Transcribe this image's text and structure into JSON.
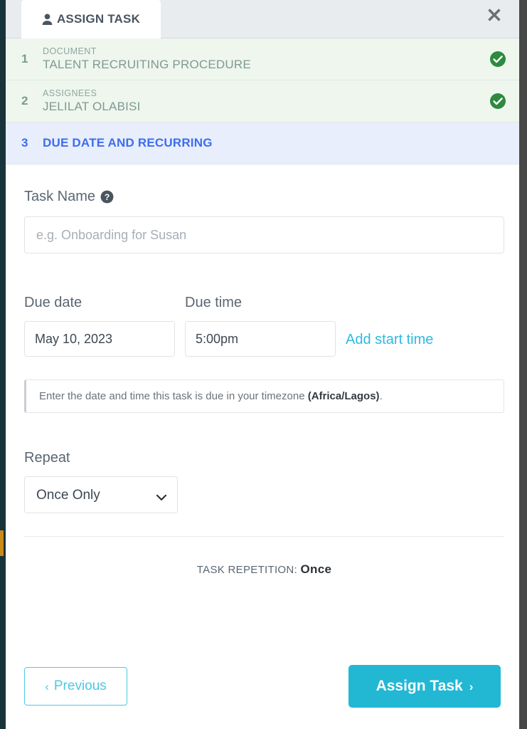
{
  "header": {
    "tab_label": "ASSIGN TASK",
    "tab_icon": "user-icon",
    "close_icon": "close-icon"
  },
  "steps": [
    {
      "number": "1",
      "sub_label": "DOCUMENT",
      "title": "TALENT RECRUITING PROCEDURE",
      "state": "completed",
      "check_icon": "check-circle-icon"
    },
    {
      "number": "2",
      "sub_label": "ASSIGNEES",
      "title": "JELILAT OLABISI",
      "state": "completed",
      "check_icon": "check-circle-icon"
    },
    {
      "number": "3",
      "sub_label": "",
      "title": "DUE DATE AND RECURRING",
      "state": "active",
      "check_icon": ""
    }
  ],
  "form": {
    "task_name_label": "Task Name",
    "task_name_help_icon": "question-circle-icon",
    "task_name_value": "",
    "task_name_placeholder": "e.g. Onboarding for Susan",
    "due_date_label": "Due date",
    "due_date_value": "May 10, 2023",
    "due_time_label": "Due time",
    "due_time_value": "5:00pm",
    "add_start_time_link": "Add start time",
    "hint_prefix": "Enter the date and time this task is due in your timezone ",
    "hint_timezone": "(Africa/Lagos)",
    "hint_suffix": ".",
    "repeat_label": "Repeat",
    "repeat_value": "Once Only",
    "repeat_options": [
      "Once Only"
    ],
    "repetition_summary_label": "TASK REPETITION:",
    "repetition_summary_value": "Once"
  },
  "footer": {
    "previous_label": "Previous",
    "previous_chevron": "‹",
    "assign_label": "Assign Task",
    "assign_chevron": "›"
  },
  "colors": {
    "accent_cyan": "#22b8d4",
    "link_cyan": "#2cbbe0",
    "active_step_blue": "#3d6cf0",
    "active_step_bg": "#e8eefb",
    "completed_step_bg": "#eef6ee",
    "completed_step_text": "#7e9a93",
    "check_green": "#2d8a3e"
  }
}
